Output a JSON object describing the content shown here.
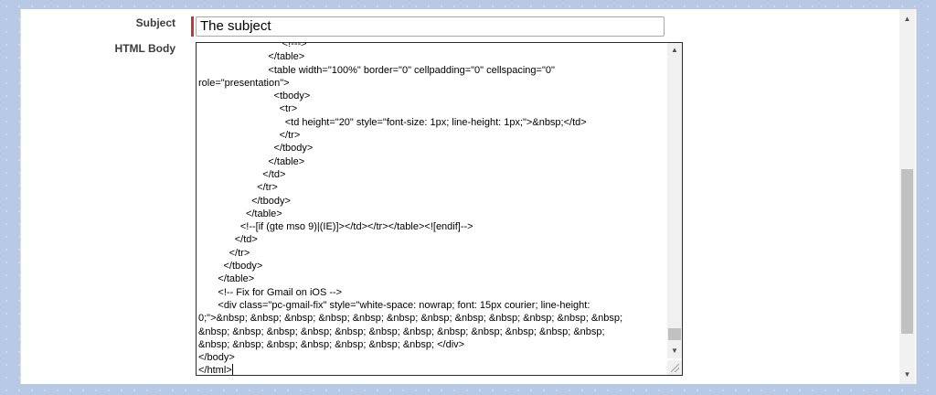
{
  "form": {
    "subject_label": "Subject",
    "subject_value": "The subject",
    "body_label": "HTML Body"
  },
  "editor": {
    "lines": [
      "                              <!--->",
      "                         </table>",
      "                         <table width=\"100%\" border=\"0\" cellpadding=\"0\" cellspacing=\"0\"",
      "role=\"presentation\">",
      "                           <tbody>",
      "                             <tr>",
      "                               <td height=\"20\" style=\"font-size: 1px; line-height: 1px;\">&nbsp;</td>",
      "                             </tr>",
      "                           </tbody>",
      "                         </table>",
      "                       </td>",
      "                     </tr>",
      "                   </tbody>",
      "                 </table>",
      "               <!--[if (gte mso 9)|(IE)]></td></tr></table><![endif]-->",
      "             </td>",
      "           </tr>",
      "         </tbody>",
      "       </table>",
      "       <!-- Fix for Gmail on iOS -->",
      "       <div class=\"pc-gmail-fix\" style=\"white-space: nowrap; font: 15px courier; line-height:",
      "0;\">&nbsp; &nbsp; &nbsp; &nbsp; &nbsp; &nbsp; &nbsp; &nbsp; &nbsp; &nbsp; &nbsp; &nbsp;",
      "&nbsp; &nbsp; &nbsp; &nbsp; &nbsp; &nbsp; &nbsp; &nbsp; &nbsp; &nbsp; &nbsp; &nbsp;",
      "&nbsp; &nbsp; &nbsp; &nbsp; &nbsp; &nbsp; &nbsp; </div>",
      "</body>",
      "</html>"
    ]
  },
  "icons": {
    "up": "▲",
    "down": "▼"
  }
}
